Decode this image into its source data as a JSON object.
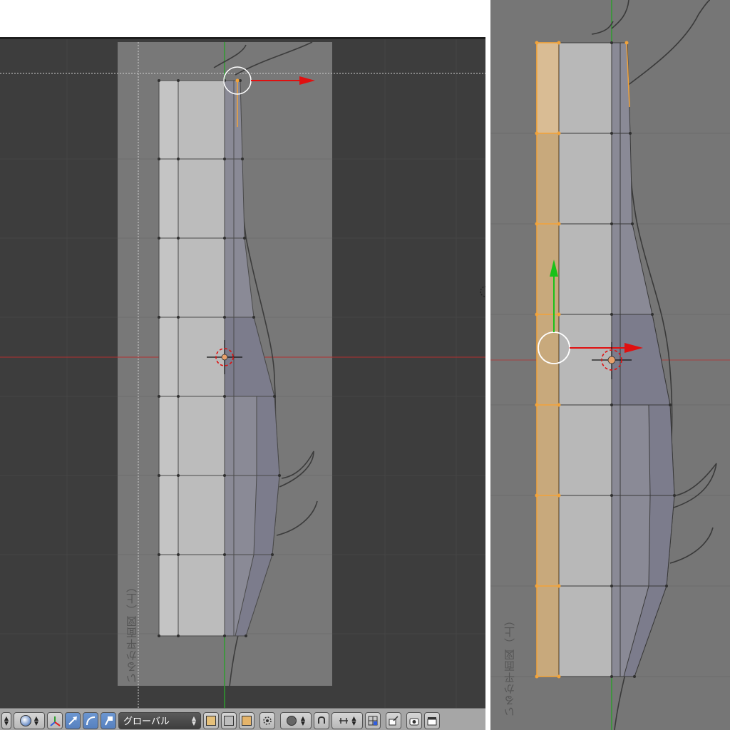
{
  "left_view": {
    "caption": "いるか平面図（上）"
  },
  "right_view": {
    "caption": "いるか平面図（上）"
  },
  "toolbar": {
    "orientation_label": "グローバル",
    "icons": [
      "shading-dropdown-icon",
      "manipulator-axis-icon",
      "translate-icon",
      "rotate-icon",
      "scale-icon",
      "solid-shading-icon",
      "wireframe-shading-icon",
      "texture-shading-icon",
      "vertex-select-icon",
      "proportional-edit-icon",
      "snap-magnet-icon",
      "snap-element-icon",
      "snap-target-icon",
      "render-icon",
      "camera-icon",
      "clapperboard-icon"
    ]
  },
  "colors": {
    "viewport_dark": "#3d3d3d",
    "viewport_gray": "#767676",
    "selection_orange": "#f2a33a",
    "x_axis_red": "#e01010",
    "y_axis_green": "#19c219"
  }
}
